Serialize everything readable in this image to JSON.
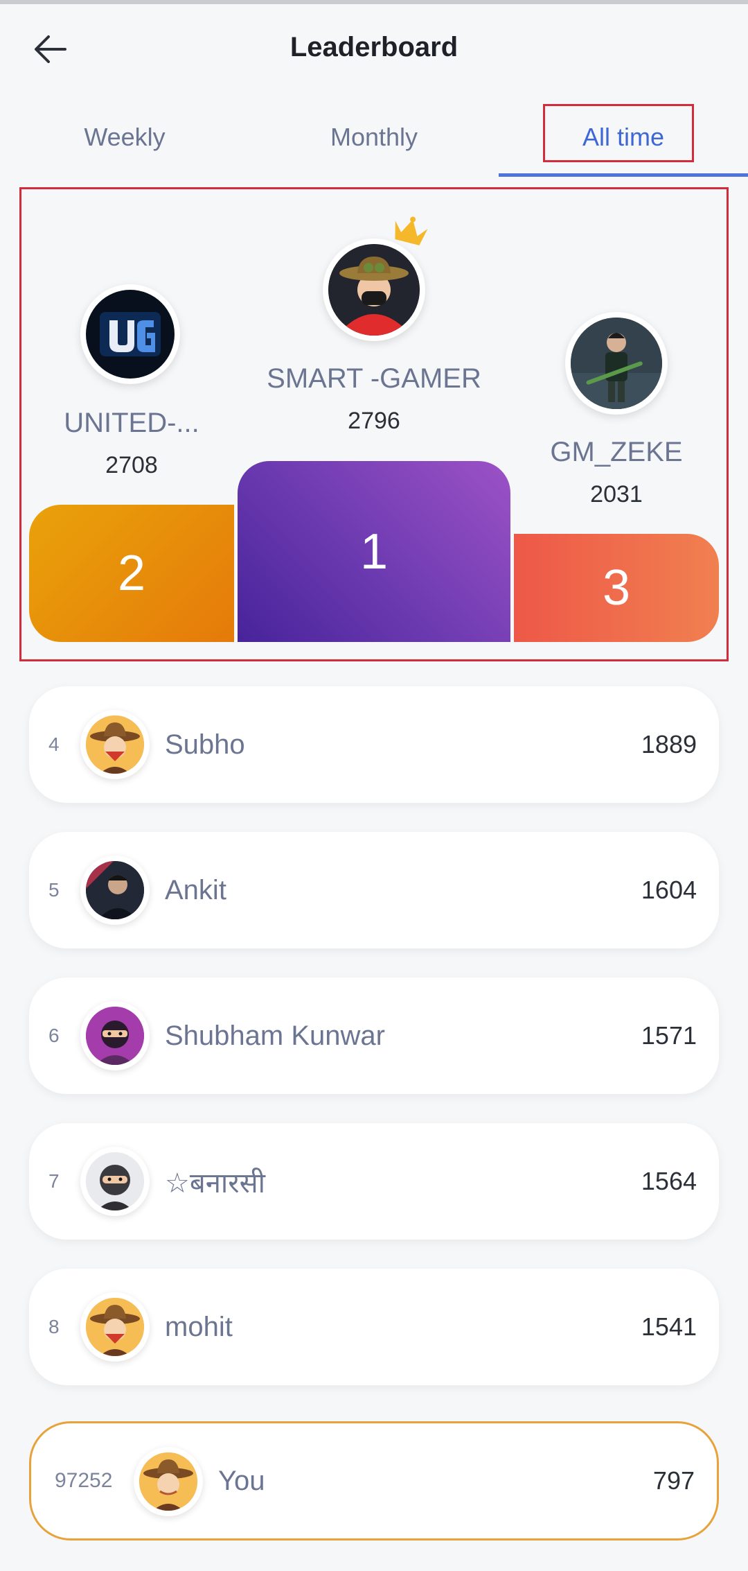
{
  "header": {
    "title": "Leaderboard",
    "back_icon": "arrow-left-icon"
  },
  "tabs": [
    {
      "label": "Weekly",
      "active": false
    },
    {
      "label": "Monthly",
      "active": false
    },
    {
      "label": "All time",
      "active": true
    }
  ],
  "podium": {
    "first": {
      "rank": "1",
      "name": "SMART -GAMER",
      "score": "2796",
      "badge": "crown-icon"
    },
    "second": {
      "rank": "2",
      "name": "UNITED-...",
      "score": "2708"
    },
    "third": {
      "rank": "3",
      "name": "GM_ZEKE",
      "score": "2031"
    }
  },
  "list": [
    {
      "rank": "4",
      "name": "Subho",
      "score": "1889"
    },
    {
      "rank": "5",
      "name": "Ankit",
      "score": "1604"
    },
    {
      "rank": "6",
      "name": "Shubham Kunwar",
      "score": "1571"
    },
    {
      "rank": "7",
      "name": "☆बनारसी",
      "score": "1564"
    },
    {
      "rank": "8",
      "name": "mohit",
      "score": "1541"
    }
  ],
  "you": {
    "rank": "97252",
    "name": "You",
    "score": "797"
  },
  "colors": {
    "accent": "#3e67d6",
    "highlight": "#d22c3c",
    "gold": "#e9a20a",
    "purple": "#6c3ab0",
    "coral": "#ee5848"
  }
}
